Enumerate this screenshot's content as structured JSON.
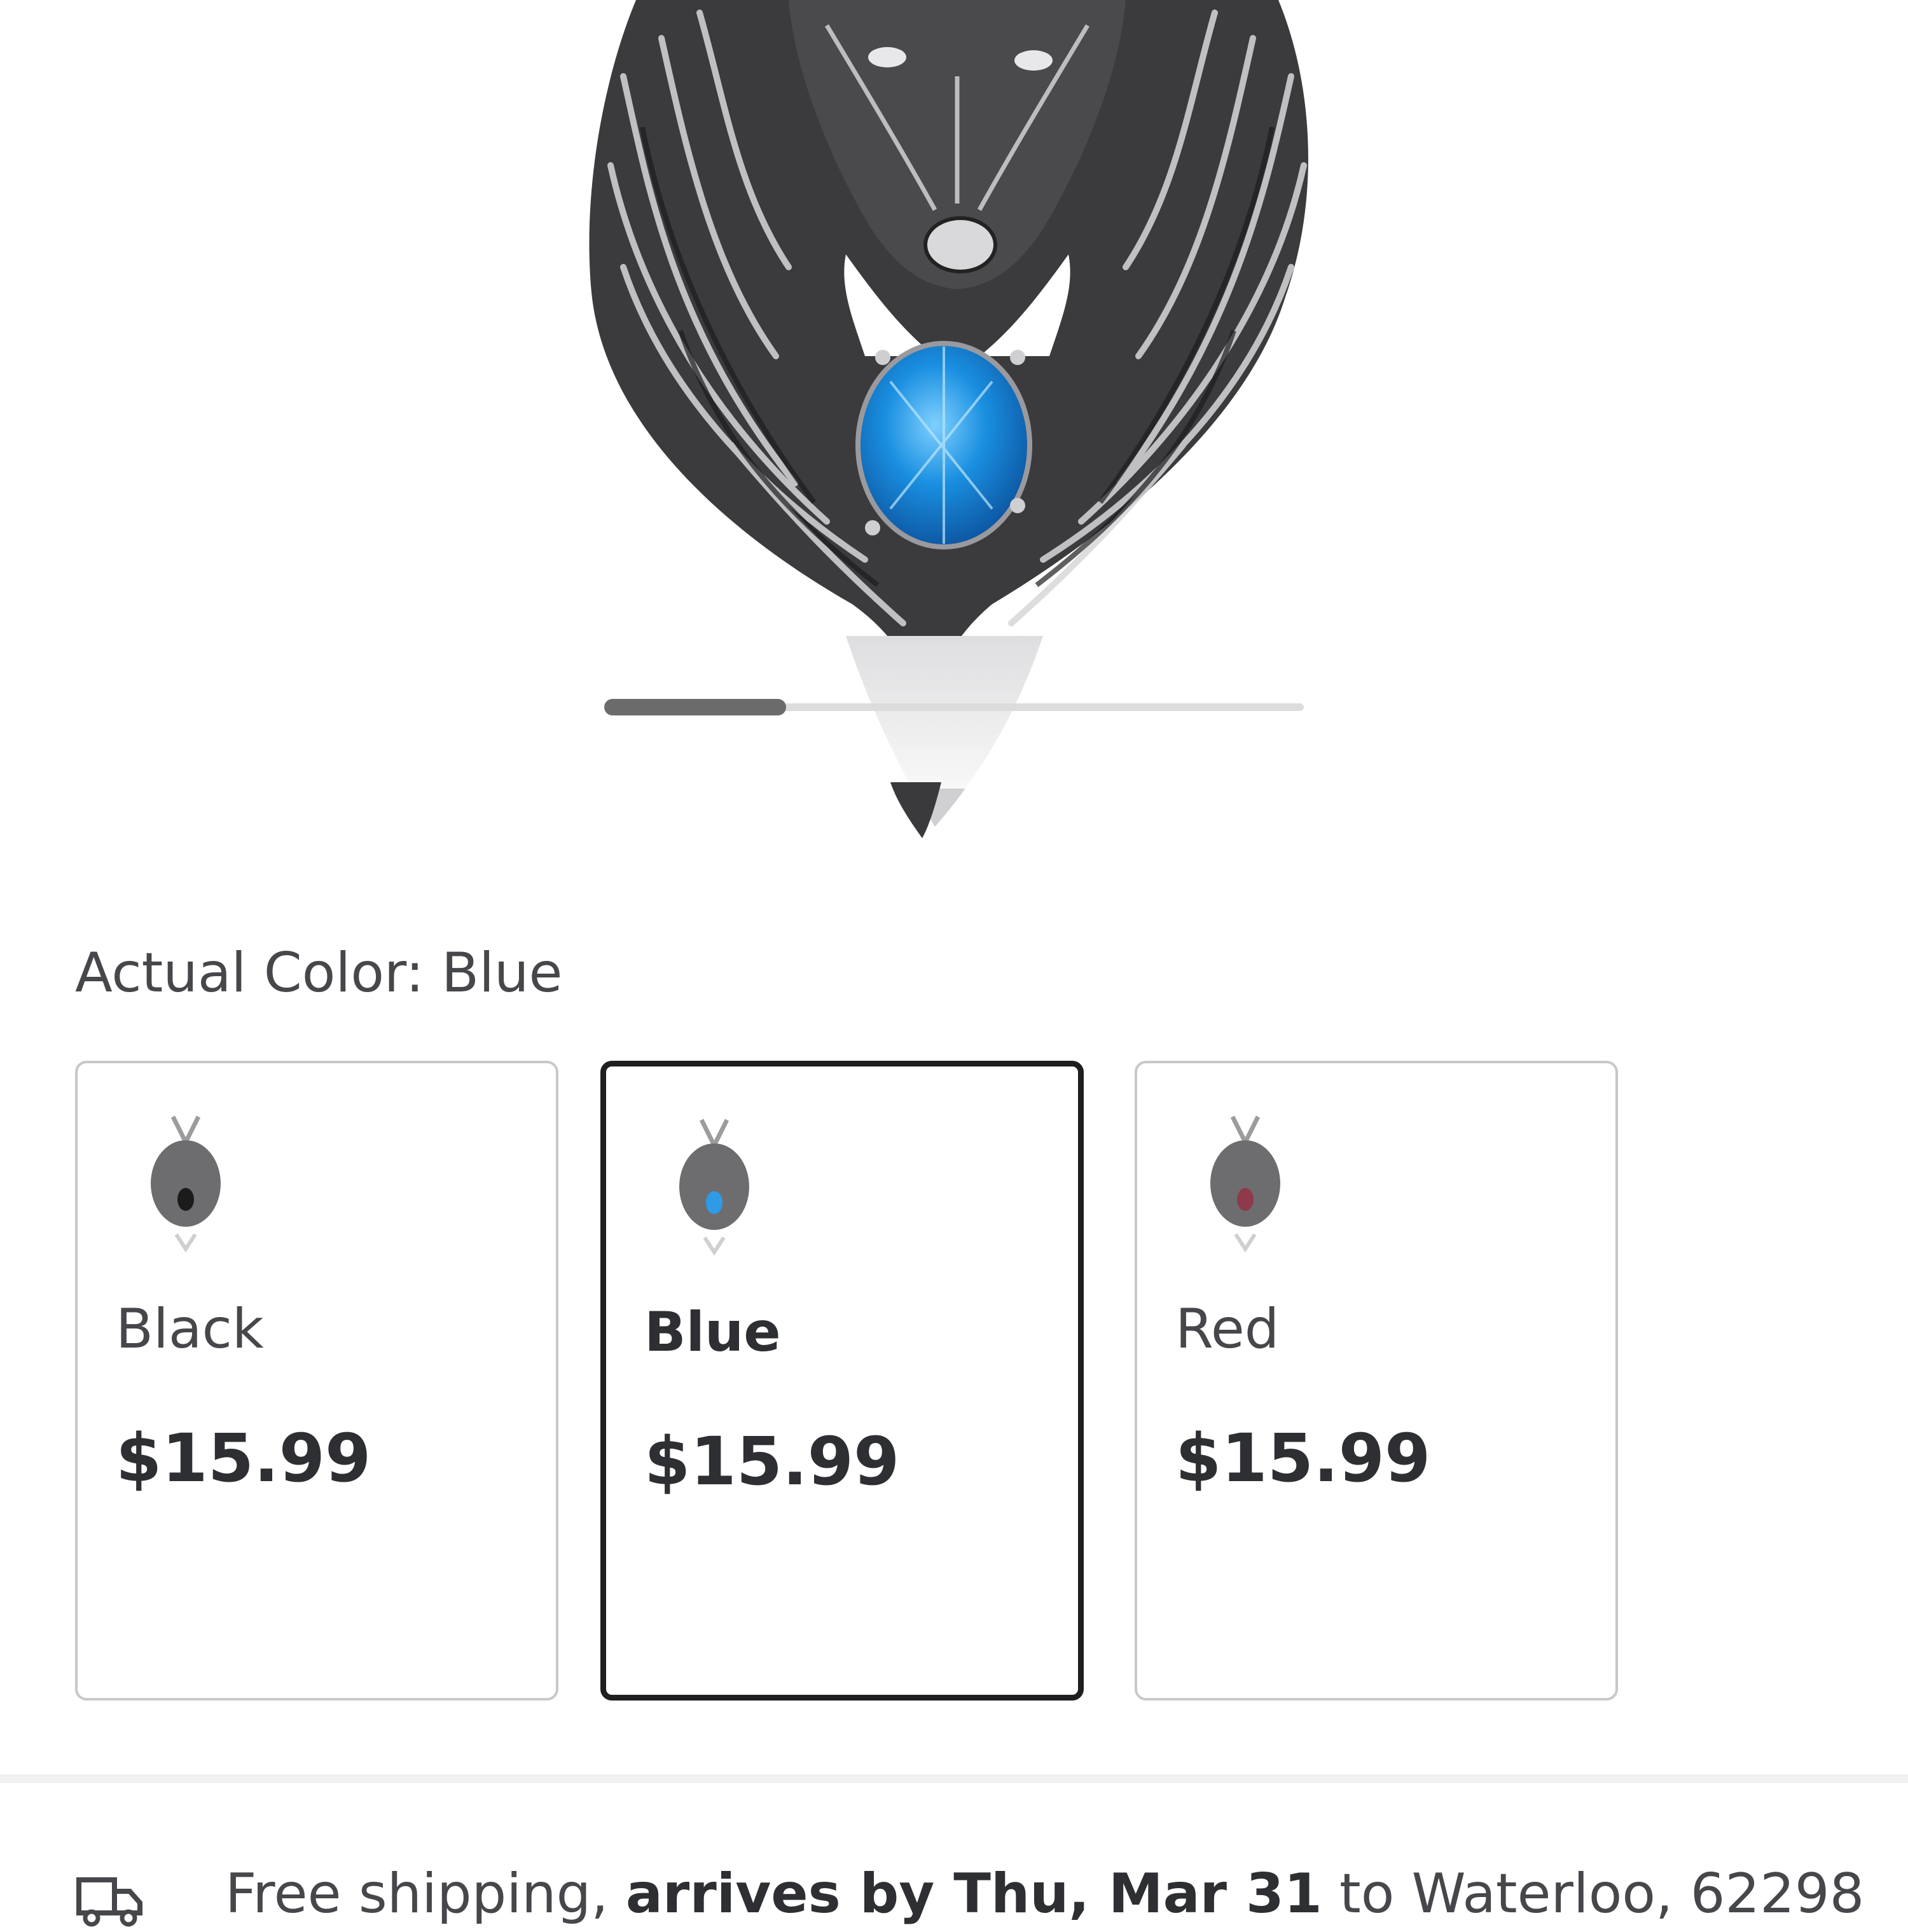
{
  "product_image": {
    "icon": "wolf-pendant-image",
    "gem_color": "#1a8fe0"
  },
  "carousel": {
    "progress": 0.26
  },
  "color_selector": {
    "label": "Actual Color: Blue",
    "options": [
      {
        "name": "Black",
        "price": "$15.99",
        "gem_color": "#1b1b1b",
        "selected": false
      },
      {
        "name": "Blue",
        "price": "$15.99",
        "gem_color": "#2e9be6",
        "selected": true
      },
      {
        "name": "Red",
        "price": "$15.99",
        "gem_color": "#8e3a4a",
        "selected": false
      }
    ]
  },
  "shipping": {
    "icon": "truck-icon",
    "lead": "Free shipping, ",
    "arrival": "arrives by Thu, Mar 31",
    "destination": " to Waterloo, 62298"
  }
}
